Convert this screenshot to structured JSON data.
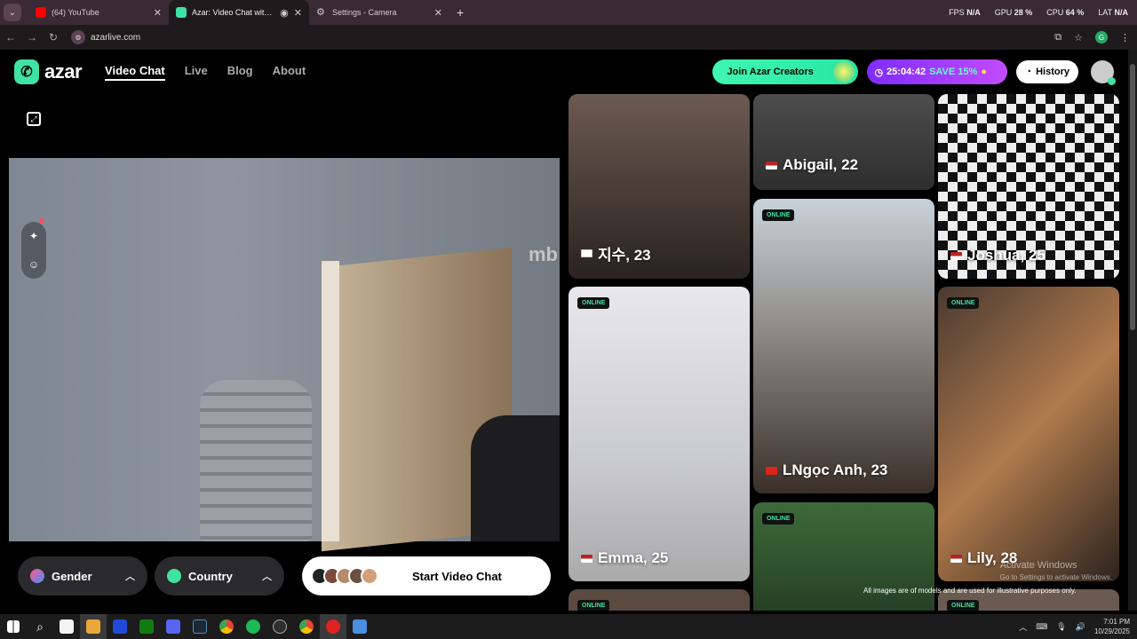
{
  "browser": {
    "tabs": [
      {
        "title": "(64) YouTube",
        "color": "#ff0000"
      },
      {
        "title": "Azar: Video Chat with New",
        "color": "#3fe3a3"
      },
      {
        "title": "Settings - Camera",
        "color": "#888888"
      }
    ],
    "url": "azarlive.com",
    "perf": {
      "fps_label": "FPS",
      "fps_value": "N/A",
      "gpu_label": "GPU",
      "gpu_value": "28 %",
      "cpu_label": "CPU",
      "cpu_value": "64 %",
      "lat_label": "LAT",
      "lat_value": "N/A"
    }
  },
  "app": {
    "logo_text": "azar",
    "nav": [
      "Video Chat",
      "Live",
      "Blog",
      "About"
    ],
    "creators_label": "Join Azar Creators",
    "timer": "25:04:42",
    "save_label": "SAVE 15%",
    "history_label": "History"
  },
  "video": {
    "watermark": "mb",
    "gender_label": "Gender",
    "country_label": "Country",
    "start_label": "Start Video Chat"
  },
  "cards": [
    {
      "name": "지수, 23",
      "online": false,
      "flag": "kr"
    },
    {
      "name": "Abigail, 22",
      "online": false,
      "flag": "us"
    },
    {
      "name": "Joshua, 25",
      "online": false,
      "flag": "us"
    },
    {
      "name": "LNgọc Anh, 23",
      "online": true,
      "flag": "vn"
    },
    {
      "name": "Emma, 25",
      "online": true,
      "flag": "us"
    },
    {
      "name": "Lily, 28",
      "online": true,
      "flag": "us"
    },
    {
      "name": "",
      "online": true,
      "flag": ""
    },
    {
      "name": "",
      "online": true,
      "flag": ""
    },
    {
      "name": "",
      "online": true,
      "flag": ""
    }
  ],
  "online_label": "ONLINE",
  "windows": {
    "activate_title": "Activate Windows",
    "activate_sub": "Go to Settings to activate Windows.",
    "disclaimer": "All images are of models and are used for illustrative purposes only."
  },
  "taskbar": {
    "time": "7:01 PM",
    "date": "10/29/2025"
  }
}
